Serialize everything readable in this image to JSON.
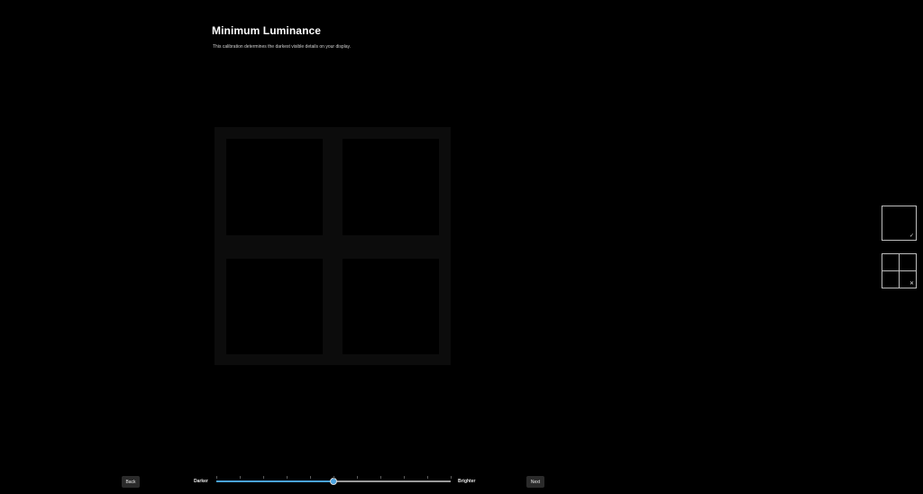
{
  "header": {
    "title": "Minimum Luminance",
    "description": "This calibration determines the darkest visible details on your display."
  },
  "references": {
    "good_mark": "✓",
    "bad_mark": "✕"
  },
  "controls": {
    "back_label": "Back",
    "next_label": "Next",
    "darker_label": "Darker",
    "brighter_label": "Brighter",
    "slider_value_fraction": 0.5,
    "tick_count": 11
  },
  "colors": {
    "accent": "#4aa3e0",
    "background": "#000000"
  }
}
